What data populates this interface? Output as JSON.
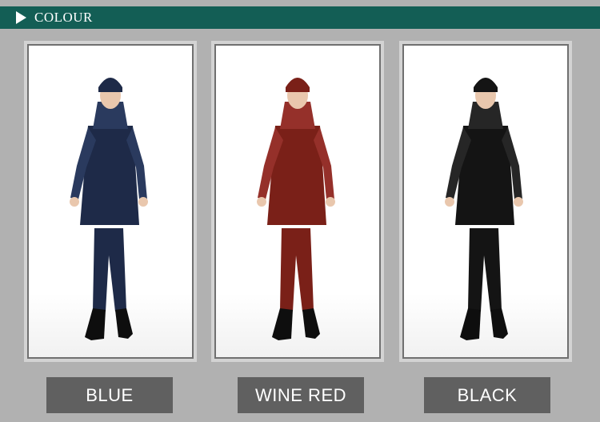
{
  "header": {
    "title": "COLOUR"
  },
  "colours": [
    {
      "label": "BLUE",
      "swatch": "#1e2a48",
      "accent": "#2a3a5e"
    },
    {
      "label": "WINE  RED",
      "swatch": "#7a2018",
      "accent": "#95302a"
    },
    {
      "label": "BLACK",
      "swatch": "#141414",
      "accent": "#262626"
    }
  ],
  "colors": {
    "header_bg": "#135e55",
    "page_bg": "#b1b1b1",
    "label_bg": "#606060",
    "label_text": "#ffffff",
    "skin": "#e9c7ad",
    "boot": "#0e0e0e"
  }
}
